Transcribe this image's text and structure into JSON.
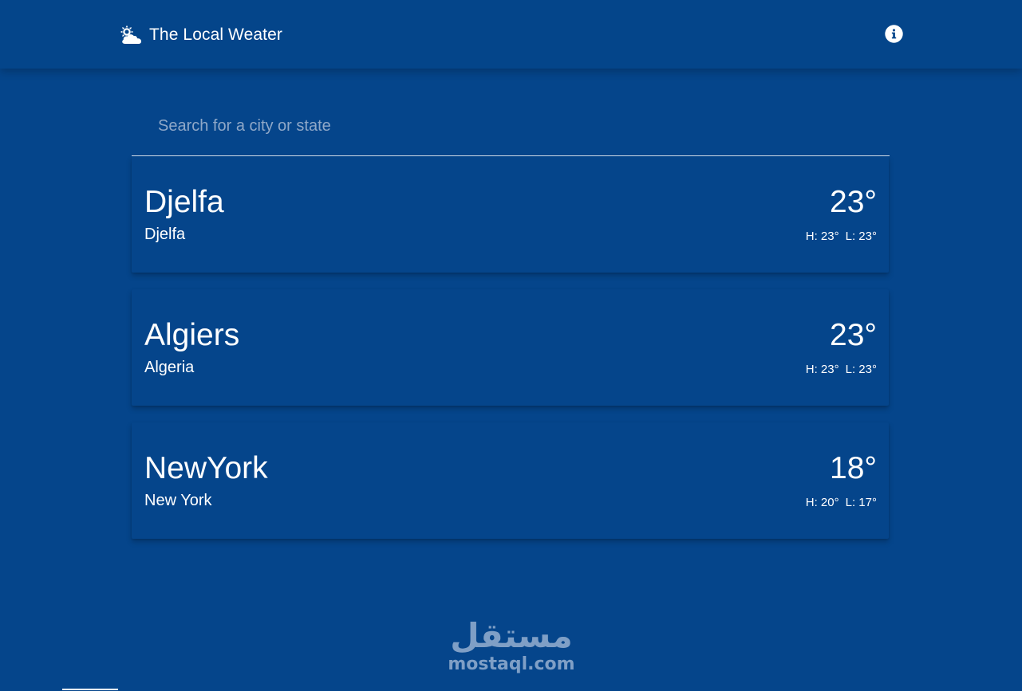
{
  "app": {
    "title": "The Local Weater",
    "brand_icon": "weather-sun-cloud-icon",
    "info_icon": "info-icon"
  },
  "search": {
    "placeholder": "Search for a city or state",
    "value": ""
  },
  "cities": [
    {
      "name": "Djelfa",
      "region": "Djelfa",
      "temperature": "23°",
      "high": "H: 23°",
      "low": "L: 23°"
    },
    {
      "name": "Algiers",
      "region": "Algeria",
      "temperature": "23°",
      "high": "H: 23°",
      "low": "L: 23°"
    },
    {
      "name": "NewYork",
      "region": "New York",
      "temperature": "18°",
      "high": "H: 20°",
      "low": "L: 17°"
    }
  ],
  "watermark": {
    "arabic": "مستقل",
    "domain": "mostaql.com"
  },
  "colors": {
    "background": "#05458b",
    "text": "#ffffff",
    "placeholder": "#8fa8c8",
    "watermark": "#7f9fc6"
  }
}
